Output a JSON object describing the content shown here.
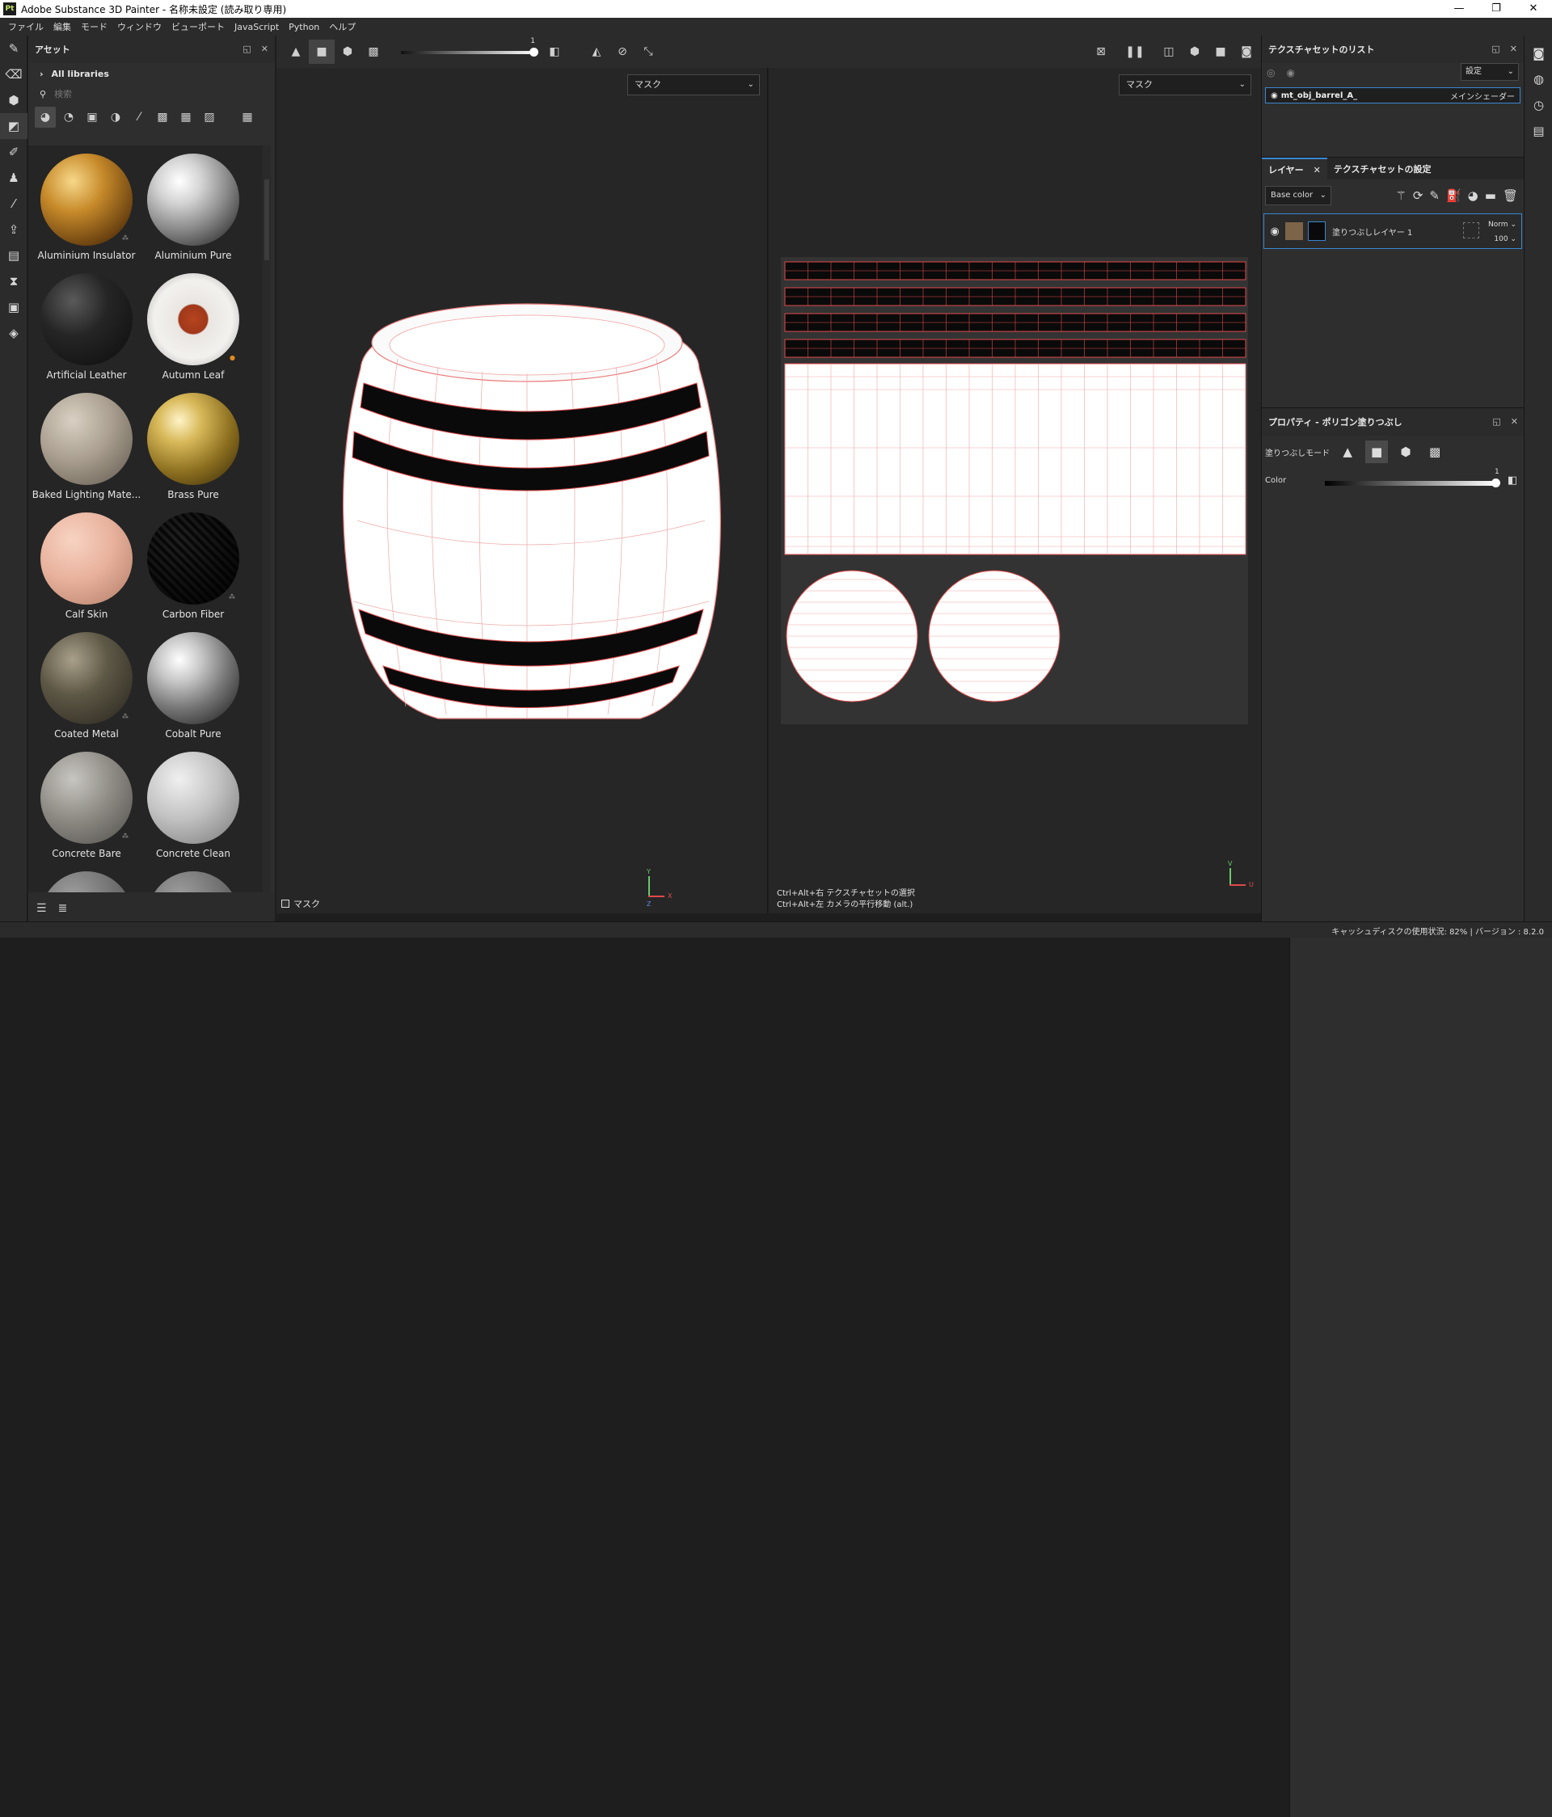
{
  "window": {
    "title": "Adobe Substance 3D Painter - 名称未設定 (読み取り専用)",
    "app_icon": "Pt",
    "controls": [
      "—",
      "❐",
      "✕"
    ]
  },
  "menu": [
    "ファイル",
    "編集",
    "モード",
    "ウィンドウ",
    "ビューポート",
    "JavaScript",
    "Python",
    "ヘルプ"
  ],
  "assets": {
    "title": "アセット",
    "library": "All libraries",
    "search_placeholder": "検索",
    "items": [
      {
        "name": "Aluminium Insulator",
        "color": "gold-tri"
      },
      {
        "name": "Aluminium Pure",
        "color": "chrome"
      },
      {
        "name": "Artificial Leather",
        "color": "black"
      },
      {
        "name": "Autumn Leaf",
        "color": "leaf"
      },
      {
        "name": "Baked Lighting Mate...",
        "color": "beige"
      },
      {
        "name": "Brass Pure",
        "color": "brass"
      },
      {
        "name": "Calf Skin",
        "color": "skin"
      },
      {
        "name": "Carbon Fiber",
        "color": "carbon"
      },
      {
        "name": "Coated Metal",
        "color": "olive"
      },
      {
        "name": "Cobalt Pure",
        "color": "chrome"
      },
      {
        "name": "Concrete Bare",
        "color": "concrete"
      },
      {
        "name": "Concrete Clean",
        "color": "lightgray"
      },
      {
        "name": "",
        "color": "gray"
      },
      {
        "name": "",
        "color": "gray"
      }
    ]
  },
  "viewport": {
    "opacity_value": "1",
    "left_channel": "マスク",
    "right_channel": "マスク",
    "mask_label": "マスク",
    "hint1": "Ctrl+Alt+右  テクスチャセットの選択",
    "hint2": "Ctrl+Alt+左  カメラの平行移動 (alt.)",
    "axis_left": {
      "y": "Y",
      "x": "X",
      "z": "Z"
    },
    "axis_right": {
      "v": "V",
      "u": "U"
    }
  },
  "texture_set_list": {
    "title": "テクスチャセットのリスト",
    "settings": "設定",
    "item": "mt_obj_barrel_A_",
    "shader": "メインシェーダー"
  },
  "layers": {
    "tab_layers": "レイヤー",
    "tab_settings": "テクスチャセットの設定",
    "channel": "Base color",
    "layer_name": "塗りつぶしレイヤー 1",
    "blend": "Norm",
    "opacity": "100"
  },
  "properties": {
    "title": "プロパティ - ポリゴン塗りつぶし",
    "fill_mode": "塗りつぶしモード",
    "color_label": "Color",
    "color_value": "1"
  },
  "status": "キャッシュディスクの使用状況:  82%  |  バージョン : 8.2.0"
}
